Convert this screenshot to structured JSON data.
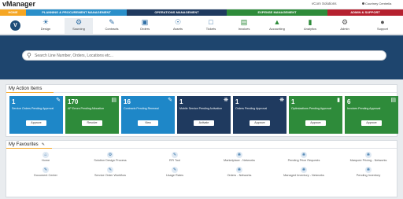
{
  "app": {
    "title": "vManager",
    "company": "vCom Solutions",
    "user": "Courtney Centrella"
  },
  "modules": [
    {
      "label": "HOME",
      "color": "#f5a623"
    },
    {
      "label": "PLANNING & PROCUREMENT MANAGEMENT",
      "color": "#2a8fc9"
    },
    {
      "label": "OPERATIONS MANAGEMENT",
      "color": "#1f3a5f"
    },
    {
      "label": "EXPENSE MANAGEMENT",
      "color": "#2e8b3a"
    },
    {
      "label": "ADMIN & SUPPORT",
      "color": "#b5212f"
    }
  ],
  "nav": {
    "logo": "V",
    "items": [
      {
        "label": "Design",
        "icon": "lightbulb-icon"
      },
      {
        "label": "Sourcing",
        "icon": "gear-icon"
      },
      {
        "label": "Contracts",
        "icon": "pen-icon"
      },
      {
        "label": "Orders",
        "icon": "cart-icon"
      },
      {
        "label": "Assets",
        "icon": "globe-icon"
      },
      {
        "label": "Tickets",
        "icon": "ticket-icon"
      },
      {
        "label": "Invoices",
        "icon": "invoice-icon"
      },
      {
        "label": "Accounting",
        "icon": "bank-icon"
      },
      {
        "label": "Analytics",
        "icon": "chart-icon"
      },
      {
        "label": "Admin",
        "icon": "gear-icon"
      },
      {
        "label": "Support",
        "icon": "user-icon"
      }
    ]
  },
  "search": {
    "placeholder": "Search Line Number, Orders, Locations etc..."
  },
  "actions": {
    "title": "My Action Items",
    "cards": [
      {
        "count": "1",
        "title": "Service Orders Pending Approval",
        "button": "Approve",
        "color": "#1e87c8",
        "icon": "pen-icon"
      },
      {
        "count": "170",
        "title": "AP Errors Pending Allocation",
        "button": "Resolve",
        "color": "#2e8b3a",
        "icon": "document-icon"
      },
      {
        "count": "16",
        "title": "Contracts Pending Renewal",
        "button": "View",
        "color": "#1e87c8",
        "icon": "pen-icon"
      },
      {
        "count": "1",
        "title": "Mobile Service Pending Activation",
        "button": "Activate",
        "color": "#1f3a5f",
        "icon": "network-icon"
      },
      {
        "count": "1",
        "title": "Orders Pending Approval",
        "button": "Approve",
        "color": "#1f3a5f",
        "icon": "network-icon"
      },
      {
        "count": "1",
        "title": "Optimizations Pending Approval",
        "button": "Approve",
        "color": "#2e8b3a",
        "icon": "chart-icon"
      },
      {
        "count": "6",
        "title": "Invoices Pending Approval",
        "button": "Approve",
        "color": "#2e8b3a",
        "icon": "invoice-icon"
      }
    ]
  },
  "favourites": {
    "title": "My Favourites",
    "items": [
      {
        "label": "Home",
        "icon": "home-icon"
      },
      {
        "label": "Solution Design Process",
        "icon": "gear-icon"
      },
      {
        "label": "RFI Tool",
        "icon": "pen-icon"
      },
      {
        "label": "Marketplace - Networks",
        "icon": "network-icon"
      },
      {
        "label": "Pending Price Requests",
        "icon": "network-icon"
      },
      {
        "label": "Marquee Pricing - Networks",
        "icon": "network-icon"
      },
      {
        "label": "Document Center",
        "icon": "pen-icon"
      },
      {
        "label": "Service Order Workflow",
        "icon": "pen-icon"
      },
      {
        "label": "Usage Rates",
        "icon": "pen-icon"
      },
      {
        "label": "Orders - Networks",
        "icon": "network-icon"
      },
      {
        "label": "Managed Inventory - Networks",
        "icon": "network-icon"
      },
      {
        "label": "Pending Inventory",
        "icon": "network-icon"
      }
    ]
  }
}
